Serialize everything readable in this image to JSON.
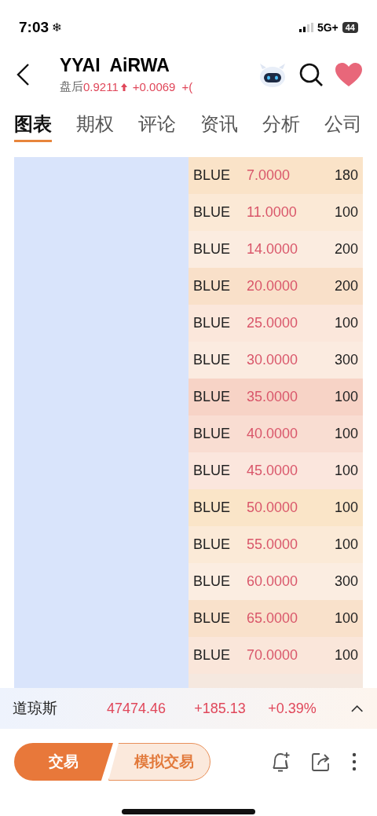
{
  "status_bar": {
    "time": "7:03",
    "time_icon": "❄",
    "network": "5G+",
    "battery": "44"
  },
  "header": {
    "title": "YYAI  AiRWA",
    "session": "盘后",
    "price": "0.9211",
    "change": "+0.0069",
    "change_pct": "+("
  },
  "tabs": [
    {
      "label": "图表",
      "selected": true
    },
    {
      "label": "期权",
      "selected": false
    },
    {
      "label": "评论",
      "selected": false
    },
    {
      "label": "资讯",
      "selected": false
    },
    {
      "label": "分析",
      "selected": false
    },
    {
      "label": "公司",
      "selected": false
    }
  ],
  "orders": [
    {
      "name": "BLUE",
      "price": "7.0000",
      "qty": "180",
      "color": "#fae3c8"
    },
    {
      "name": "BLUE",
      "price": "11.0000",
      "qty": "100",
      "color": "#fbe9d6"
    },
    {
      "name": "BLUE",
      "price": "14.0000",
      "qty": "200",
      "color": "#fbece0"
    },
    {
      "name": "BLUE",
      "price": "20.0000",
      "qty": "200",
      "color": "#f9e0c9"
    },
    {
      "name": "BLUE",
      "price": "25.0000",
      "qty": "100",
      "color": "#fbe7db"
    },
    {
      "name": "BLUE",
      "price": "30.0000",
      "qty": "300",
      "color": "#fbebe0"
    },
    {
      "name": "BLUE",
      "price": "35.0000",
      "qty": "100",
      "color": "#f7d3c6"
    },
    {
      "name": "BLUE",
      "price": "40.0000",
      "qty": "100",
      "color": "#f9ddd2"
    },
    {
      "name": "BLUE",
      "price": "45.0000",
      "qty": "100",
      "color": "#fbe6dd"
    },
    {
      "name": "BLUE",
      "price": "50.0000",
      "qty": "100",
      "color": "#fae5c8"
    },
    {
      "name": "BLUE",
      "price": "55.0000",
      "qty": "100",
      "color": "#fbead7"
    },
    {
      "name": "BLUE",
      "price": "60.0000",
      "qty": "300",
      "color": "#fbede1"
    },
    {
      "name": "BLUE",
      "price": "65.0000",
      "qty": "100",
      "color": "#f9e1cb"
    },
    {
      "name": "BLUE",
      "price": "70.0000",
      "qty": "100",
      "color": "#fae6da"
    }
  ],
  "index_ticker": {
    "name": "道琼斯",
    "value": "47474.46",
    "change": "+185.13",
    "change_pct": "+0.39%"
  },
  "bottom_bar": {
    "trade": "交易",
    "paper_trade": "模拟交易"
  }
}
